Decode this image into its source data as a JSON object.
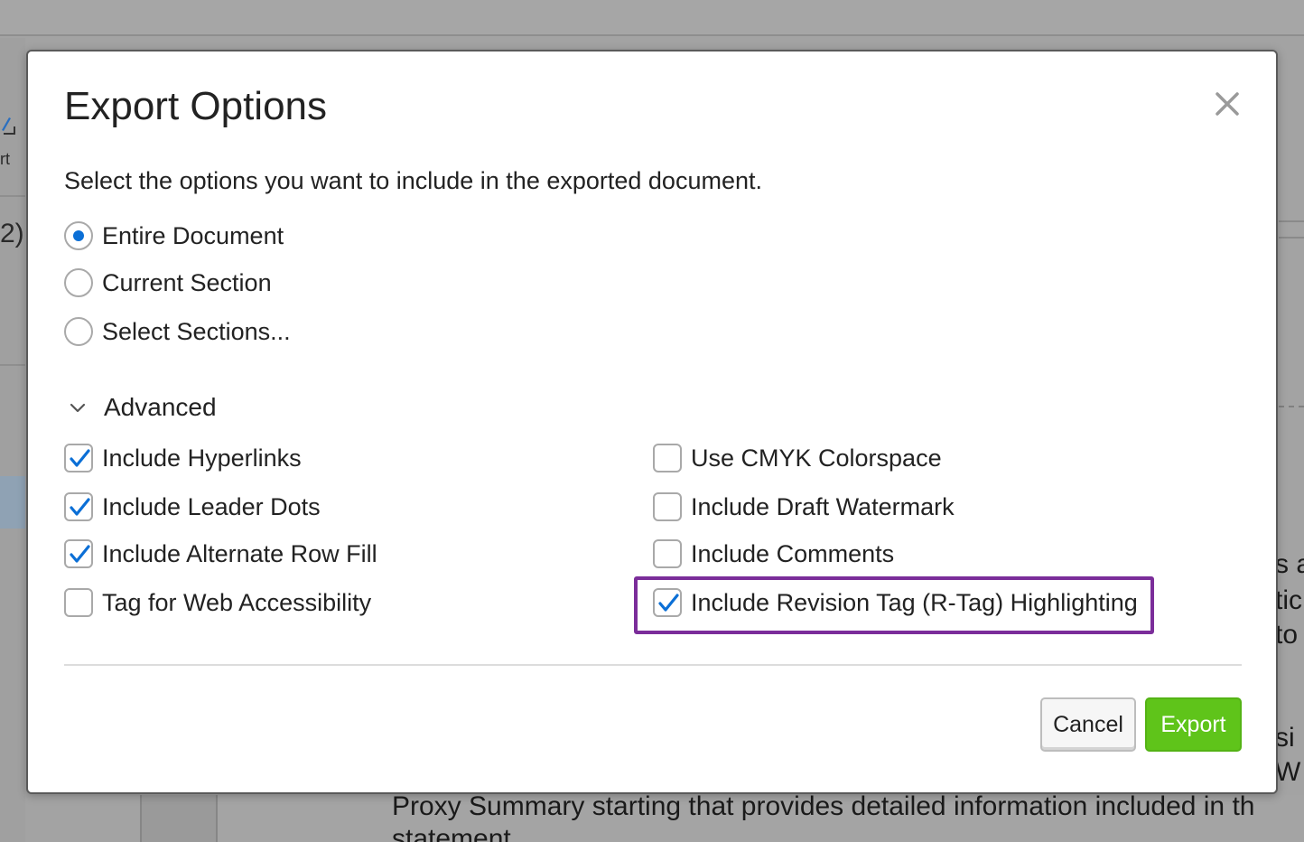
{
  "dialog": {
    "title": "Export Options",
    "intro": "Select the options you want to include in the exported document."
  },
  "scope_options": [
    {
      "label": "Entire Document",
      "selected": true
    },
    {
      "label": "Current Section",
      "selected": false
    },
    {
      "label": "Select Sections...",
      "selected": false
    }
  ],
  "advanced": {
    "label": "Advanced",
    "expanded": true,
    "left": [
      {
        "label": "Include Hyperlinks",
        "checked": true
      },
      {
        "label": "Include Leader Dots",
        "checked": true
      },
      {
        "label": "Include Alternate Row Fill",
        "checked": true
      },
      {
        "label": "Tag for Web Accessibility",
        "checked": false
      }
    ],
    "right": [
      {
        "label": "Use CMYK Colorspace",
        "checked": false
      },
      {
        "label": "Include Draft Watermark",
        "checked": false
      },
      {
        "label": "Include Comments",
        "checked": false
      },
      {
        "label": "Include Revision Tag (R-Tag) Highlighting",
        "checked": true,
        "highlighted": true
      }
    ]
  },
  "buttons": {
    "cancel": "Cancel",
    "export": "Export"
  },
  "background": {
    "left_fragments": [
      "rt",
      "2)"
    ],
    "doc_line_1": "Proxy Summary starting that provides detailed information included in th",
    "doc_line_2": "statement",
    "right_fragments": [
      "s a",
      "tic",
      "to",
      "si",
      "W"
    ]
  },
  "colors": {
    "accent_blue": "#0b6fd6",
    "export_green": "#5fc41a",
    "highlight_purple": "#7b2d9a"
  }
}
